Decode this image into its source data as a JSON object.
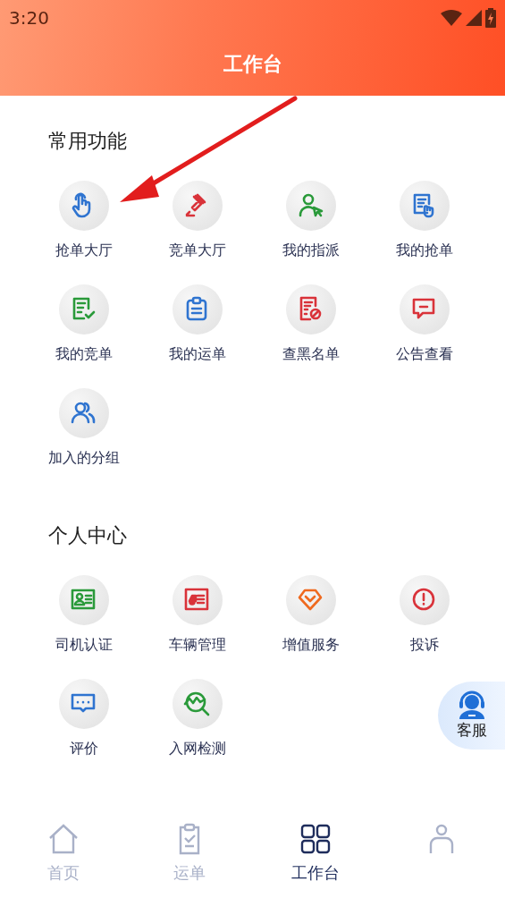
{
  "status_bar": {
    "time": "3:20"
  },
  "header": {
    "title": "工作台"
  },
  "sections": [
    {
      "title": "常用功能",
      "items": [
        {
          "label": "抢单大厅",
          "color": "#2f74d0"
        },
        {
          "label": "竞单大厅",
          "color": "#d9333a"
        },
        {
          "label": "我的指派",
          "color": "#2a9a3a"
        },
        {
          "label": "我的抢单",
          "color": "#2f74d0"
        },
        {
          "label": "我的竞单",
          "color": "#2a9a3a"
        },
        {
          "label": "我的运单",
          "color": "#2f74d0"
        },
        {
          "label": "查黑名单",
          "color": "#d9333a"
        },
        {
          "label": "公告查看",
          "color": "#d9333a"
        },
        {
          "label": "加入的分组",
          "color": "#2f74d0"
        }
      ]
    },
    {
      "title": "个人中心",
      "items": [
        {
          "label": "司机认证",
          "color": "#2a9a3a"
        },
        {
          "label": "车辆管理",
          "color": "#d9333a"
        },
        {
          "label": "增值服务",
          "color": "#ef6a1f"
        },
        {
          "label": "投诉",
          "color": "#d9333a"
        },
        {
          "label": "评价",
          "color": "#2f74d0"
        },
        {
          "label": "入网检测",
          "color": "#2a9a3a"
        }
      ]
    }
  ],
  "support_button": {
    "label": "客服"
  },
  "tabs": [
    {
      "label": "首页",
      "selected": false
    },
    {
      "label": "运单",
      "selected": false
    },
    {
      "label": "工作台",
      "selected": true
    },
    {
      "selected": false
    }
  ]
}
